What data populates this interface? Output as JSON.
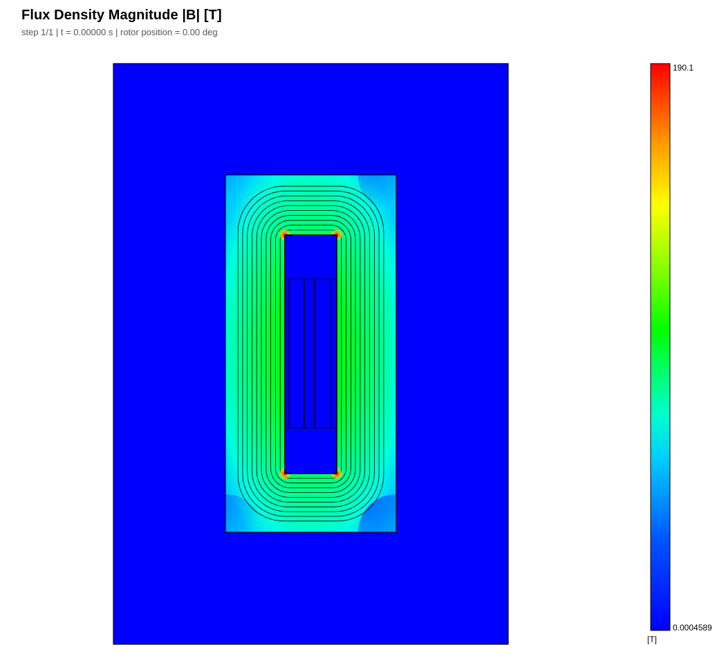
{
  "plot": {
    "title": "Flux Density Magnitude |B|  [T]",
    "subtitle": "step 1/1  |  t = 0.00000 s  |  rotor position = 0.00 deg"
  },
  "colorbar": {
    "max_label": "190.1",
    "min_label": "0.0004589",
    "unit_label": "[T]",
    "max_value": 190.1,
    "min_value": 0.0004589,
    "colormap": "jet"
  },
  "colors": {
    "background_field": "#0000ff",
    "core_base": "#00ee66",
    "core_outer": "#00ffee",
    "hotspot": "#ff2200",
    "contour_line": "#000000"
  },
  "chart_data": {
    "type": "heatmap",
    "title": "Flux Density Magnitude |B|  [T]",
    "subtitle": "step 1/1  |  t = 0.00000 s  |  rotor position = 0.00 deg",
    "quantity": "|B|",
    "unit": "[T]",
    "range": [
      0.0004589,
      190.1
    ],
    "colormap": "jet",
    "contour_lines": 10,
    "legend_placement": "right"
  }
}
